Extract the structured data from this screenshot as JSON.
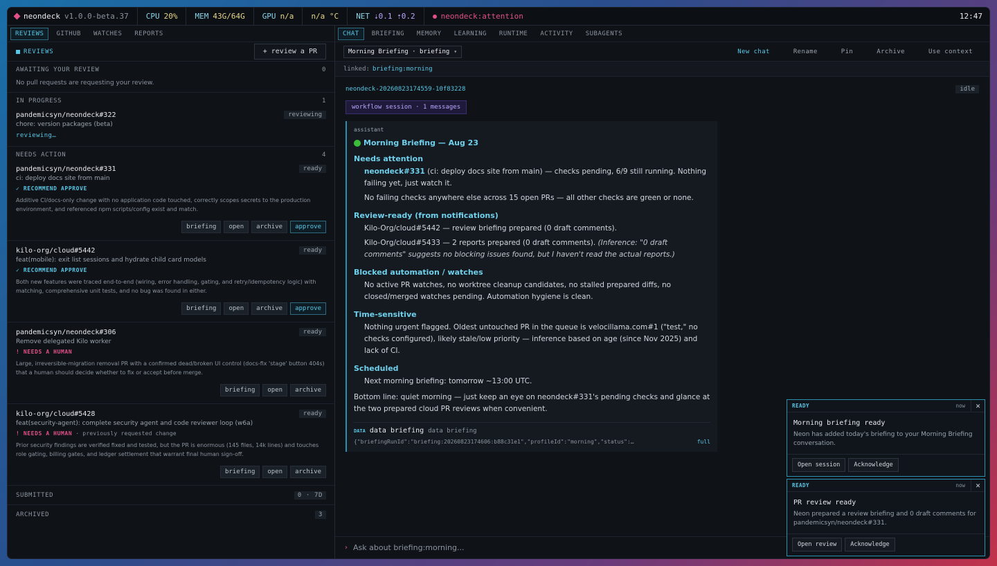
{
  "topbar": {
    "brand": "neondeck",
    "version": "v1.0.0-beta.37",
    "cpu_label": "CPU",
    "cpu_value": "20%",
    "mem_label": "MEM",
    "mem_value": "43G/64G",
    "gpu_label": "GPU",
    "gpu_value": "n/a",
    "temp_value": "n/a °C",
    "net_label": "NET",
    "net_value": "⇣0.1 ⇡0.2",
    "attention": "neondeck:attention",
    "clock": "12:47"
  },
  "left_tabs": [
    "REVIEWS",
    "GITHUB",
    "WATCHES",
    "REPORTS"
  ],
  "reviews": {
    "title": "REVIEWS",
    "review_button": "+ review a PR",
    "awaiting": {
      "label": "AWAITING YOUR REVIEW",
      "count": "0",
      "empty_text": "No pull requests are requesting your review."
    },
    "in_progress": {
      "label": "IN PROGRESS",
      "count": "1",
      "item": {
        "name": "pandemicsyn/neondeck#322",
        "badge": "reviewing",
        "desc": "chore: version packages (beta)",
        "status": "reviewing…"
      }
    },
    "needs_action": {
      "label": "NEEDS ACTION",
      "count": "4",
      "items": [
        {
          "name": "pandemicsyn/neondeck#331",
          "badge": "ready",
          "desc": "ci: deploy docs site from main",
          "rec": "✓ RECOMMEND APPROVE",
          "summary": "Additive CI/docs-only change with no application code touched, correctly scopes secrets to the production environment, and referenced npm scripts/config exist and match.",
          "actions": [
            "briefing",
            "open",
            "archive",
            "approve"
          ]
        },
        {
          "name": "kilo-org/cloud#5442",
          "badge": "ready",
          "desc": "feat(mobile): exit list sessions and hydrate child card models",
          "rec": "✓ RECOMMEND APPROVE",
          "summary": "Both new features were traced end-to-end (wiring, error handling, gating, and retry/idempotency logic) with matching, comprehensive unit tests, and no bug was found in either.",
          "actions": [
            "briefing",
            "open",
            "archive",
            "approve"
          ]
        },
        {
          "name": "pandemicsyn/neondeck#306",
          "badge": "ready",
          "desc": "Remove delegated Kilo worker",
          "rec": "! NEEDS A HUMAN",
          "summary": "Large, irreversible-migration removal PR with a confirmed dead/broken UI control (docs-fix 'stage' button 404s) that a human should decide whether to fix or accept before merge.",
          "actions": [
            "briefing",
            "open",
            "archive"
          ]
        },
        {
          "name": "kilo-org/cloud#5428",
          "badge": "ready",
          "desc": "feat(security-agent): complete security agent and code reviewer loop (w6a)",
          "rec": "! NEEDS A HUMAN",
          "rec_sub": " · previously requested change",
          "summary": "Prior security findings are verified fixed and tested, but the PR is enormous (145 files, 14k lines) and touches role gating, billing gates, and ledger settlement that warrant final human sign-off.",
          "actions": [
            "briefing",
            "open",
            "archive"
          ]
        }
      ]
    },
    "submitted": {
      "label": "SUBMITTED",
      "badge": "0 · 7D"
    },
    "archived": {
      "label": "ARCHIVED",
      "badge": "3"
    }
  },
  "right_tabs": [
    "CHAT",
    "BRIEFING",
    "MEMORY",
    "LEARNING",
    "RUNTIME",
    "ACTIVITY",
    "SUBAGENTS"
  ],
  "chat": {
    "selector": "Morning Briefing · briefing",
    "actions": [
      "New chat",
      "Rename",
      "Pin",
      "Archive",
      "Use context"
    ],
    "linked_label": "linked:",
    "linked_value": "briefing:morning",
    "session_id": "neondeck-20260823174559-10f83228",
    "session_state": "idle",
    "workflow": "workflow session · 1 messages",
    "message": {
      "role": "assistant",
      "title": "Morning Briefing — Aug 23",
      "h_attention": "Needs attention",
      "p1_link": "neondeck#331",
      "p1_rest": " (ci: deploy docs site from main) — checks pending, 6/9 still running. Nothing failing yet, just watch it.",
      "p2": "No failing checks anywhere else across 15 open PRs — all other checks are green or none.",
      "h_review": "Review-ready (from notifications)",
      "p3": "Kilo-Org/cloud#5442 — review briefing prepared (0 draft comments).",
      "p4": "Kilo-Org/cloud#5433 — 2 reports prepared (0 draft comments). ",
      "p4_em": "(Inference: \"0 draft comments\" suggests no blocking issues found, but I haven't read the actual reports.)",
      "h_blocked": "Blocked automation / watches",
      "p5": "No active PR watches, no worktree cleanup candidates, no stalled prepared diffs, no closed/merged watches pending. Automation hygiene is clean.",
      "h_time": "Time-sensitive",
      "p6": "Nothing urgent flagged. Oldest untouched PR in the queue is velocillama.com#1 (\"test,\" no checks configured), likely stale/low priority — inference based on age (since Nov 2025) and lack of CI.",
      "h_sched": "Scheduled",
      "p7": "Next morning briefing: tomorrow ~13:00 UTC.",
      "p8": "Bottom line: quiet morning — just keep an eye on neondeck#331's pending checks and glance at the two prepared cloud PR reviews when convenient.",
      "data_tag": "DATA",
      "data_name": "data briefing",
      "data_sub": "data briefing",
      "json": "{\"briefingRunId\":\"briefing:20260823174606:b88c31e1\",\"profileId\":\"morning\",\"status\":…",
      "full": "full"
    },
    "composer_placeholder": "Ask about briefing:morning..."
  },
  "toasts": [
    {
      "state": "READY",
      "time": "now",
      "title": "Morning briefing ready",
      "desc": "Neon has added today's briefing to your Morning Briefing conversation.",
      "btn1": "Open session",
      "btn2": "Acknowledge"
    },
    {
      "state": "READY",
      "time": "now",
      "title": "PR review ready",
      "desc": "Neon prepared a review briefing and 0 draft comments for pandemicsyn/neondeck#331.",
      "btn1": "Open review",
      "btn2": "Acknowledge"
    }
  ]
}
